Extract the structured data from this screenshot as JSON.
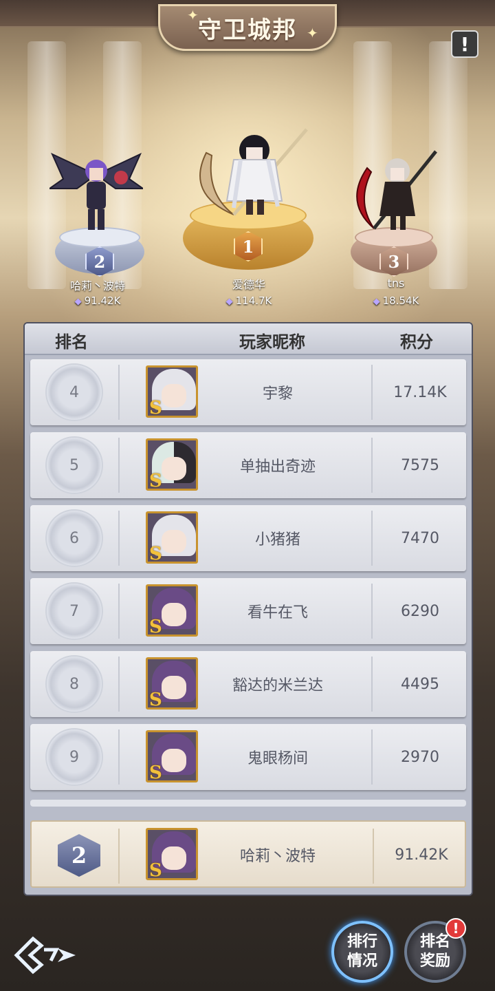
{
  "header": {
    "title": "守卫城邦",
    "info_icon": "exclamation-icon",
    "info_glyph": "!"
  },
  "podium": [
    {
      "rank": "2",
      "name": "哈莉丶波特",
      "score": "91.42K"
    },
    {
      "rank": "1",
      "name": "爱德华",
      "score": "114.7K"
    },
    {
      "rank": "3",
      "name": "tns",
      "score": "18.54K"
    }
  ],
  "table": {
    "columns": [
      "排名",
      "玩家昵称",
      "积分"
    ],
    "rows": [
      {
        "rank": "4",
        "name": "宇黎",
        "score": "17.14K"
      },
      {
        "rank": "5",
        "name": "单抽出奇迹",
        "score": "7575"
      },
      {
        "rank": "6",
        "name": "小猪猪",
        "score": "7470"
      },
      {
        "rank": "7",
        "name": "看牛在飞",
        "score": "6290"
      },
      {
        "rank": "8",
        "name": "豁达的米兰达",
        "score": "4495"
      },
      {
        "rank": "9",
        "name": "鬼眼杨间",
        "score": "2970"
      }
    ],
    "self": {
      "rank": "2",
      "name": "哈莉丶波特",
      "score": "91.42K"
    }
  },
  "buttons": {
    "ranking_status_line1": "排行",
    "ranking_status_line2": "情况",
    "ranking_reward_line1": "排名",
    "ranking_reward_line2": "奖励",
    "notify_glyph": "!"
  },
  "colors": {
    "medal_gold": "#d9953a",
    "medal_silver": "#7f8fbf",
    "medal_bronze": "#a07a66",
    "accent_blue": "#7ec1ff",
    "notify_red": "#e23a3a"
  }
}
